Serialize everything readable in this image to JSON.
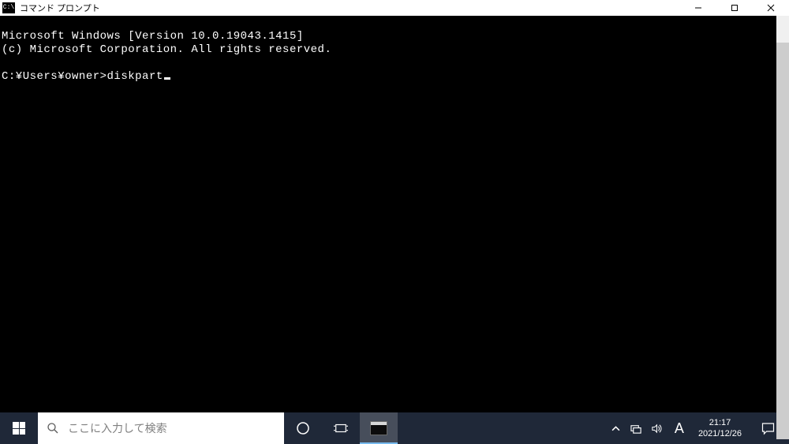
{
  "window": {
    "title": "コマンド プロンプト",
    "icon_label": "C:\\"
  },
  "terminal": {
    "line1": "Microsoft Windows [Version 10.0.19043.1415]",
    "line2": "(c) Microsoft Corporation. All rights reserved.",
    "prompt": "C:¥Users¥owner>",
    "command": "diskpart"
  },
  "taskbar": {
    "search_placeholder": "ここに入力して検索",
    "ime": "A",
    "time": "21:17",
    "date": "2021/12/26"
  }
}
